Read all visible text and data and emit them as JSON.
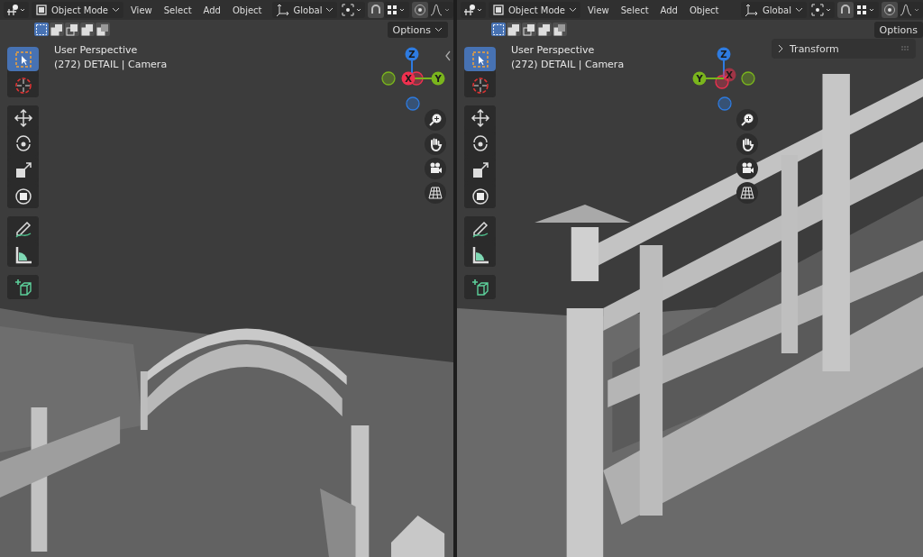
{
  "viewports": [
    {
      "header": {
        "mode": "Object Mode",
        "menus": [
          "View",
          "Select",
          "Add",
          "Object"
        ],
        "orientation": "Global",
        "proportional_on": true
      },
      "select_modes": [
        {
          "selected": true
        },
        {
          "selected": false
        },
        {
          "selected": false
        },
        {
          "selected": false
        },
        {
          "selected": false
        }
      ],
      "options": "Options",
      "overlay": {
        "title": "User Perspective",
        "subtitle": "(272) DETAIL | Camera"
      },
      "gizmo": [
        {
          "label": "Z",
          "color": "#2e7be0"
        },
        {
          "label": "X",
          "color": "#f0304f"
        },
        {
          "label": "Y",
          "color": "#7ab51d"
        }
      ],
      "tool_groups": [
        [
          {
            "kind": "select",
            "selected": true
          },
          {
            "kind": "cursor",
            "selected": false
          }
        ],
        [
          {
            "kind": "move",
            "selected": false
          },
          {
            "kind": "rotate",
            "selected": false
          },
          {
            "kind": "scale",
            "selected": false
          },
          {
            "kind": "transform",
            "selected": false
          }
        ],
        [
          {
            "kind": "annotate",
            "selected": false
          },
          {
            "kind": "measure",
            "selected": false
          }
        ],
        [
          {
            "kind": "add-cube",
            "selected": false
          }
        ]
      ]
    },
    {
      "header": {
        "mode": "Object Mode",
        "menus": [
          "View",
          "Select",
          "Add",
          "Object"
        ],
        "orientation": "Global",
        "proportional_on": true
      },
      "select_modes": [
        {
          "selected": true
        },
        {
          "selected": false
        },
        {
          "selected": false
        },
        {
          "selected": false
        },
        {
          "selected": false
        }
      ],
      "options": "Options",
      "overlay": {
        "title": "User Perspective",
        "subtitle": "(272) DETAIL | Camera"
      },
      "gizmo": [
        {
          "label": "Z",
          "color": "#2e7be0"
        },
        {
          "label": "X",
          "color": "#f0304f"
        },
        {
          "label": "Y",
          "color": "#7ab51d"
        }
      ],
      "sidebar_panel": {
        "label": "Transform",
        "expanded": false
      },
      "tool_groups": [
        [
          {
            "kind": "select",
            "selected": true
          },
          {
            "kind": "cursor",
            "selected": false
          }
        ],
        [
          {
            "kind": "move",
            "selected": false
          },
          {
            "kind": "rotate",
            "selected": false
          },
          {
            "kind": "scale",
            "selected": false
          },
          {
            "kind": "transform",
            "selected": false
          }
        ],
        [
          {
            "kind": "annotate",
            "selected": false
          },
          {
            "kind": "measure",
            "selected": false
          }
        ],
        [
          {
            "kind": "add-cube",
            "selected": false
          }
        ]
      ]
    }
  ]
}
